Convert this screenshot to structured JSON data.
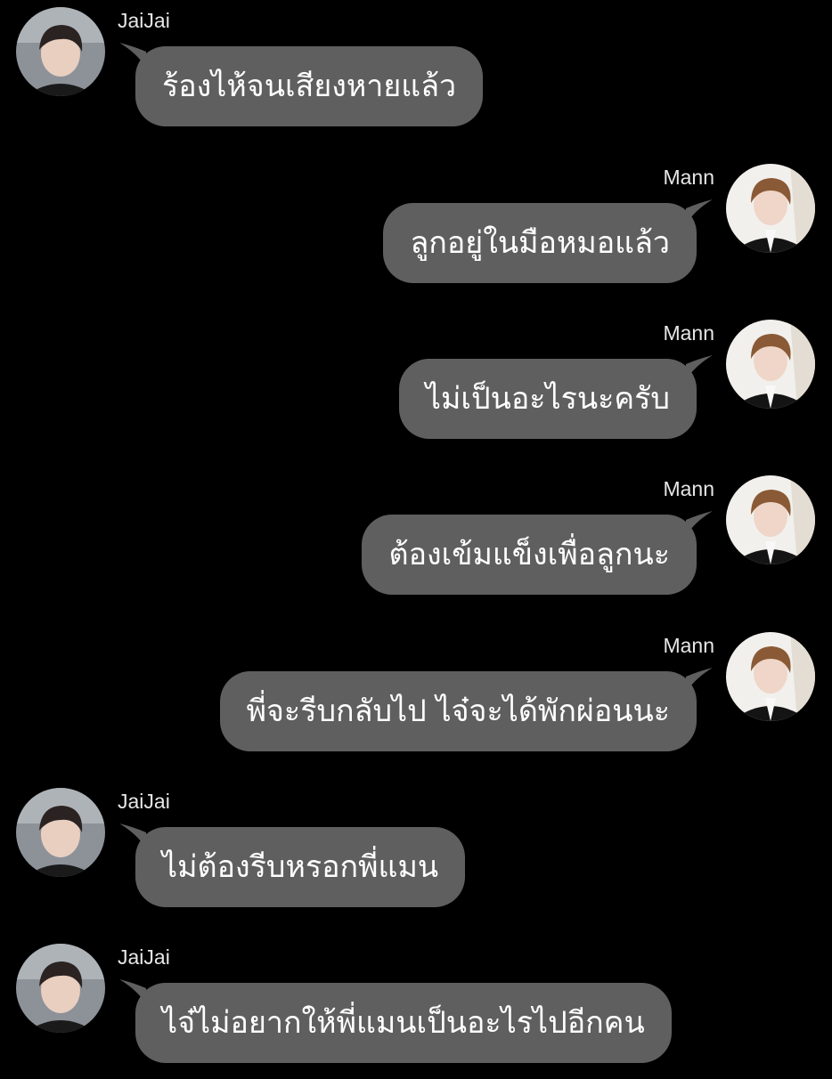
{
  "theme": {
    "background": "#000000",
    "bubble_color": "#5f5f5f",
    "text_color": "#ffffff",
    "name_color": "#e6e6e6"
  },
  "messages": [
    {
      "sender": "JaiJai",
      "side": "left",
      "avatar": "jaijai-avatar",
      "text": "ร้องไห้จนเสียงหายแล้ว"
    },
    {
      "sender": "Mann",
      "side": "right",
      "avatar": "mann-avatar",
      "text": "ลูกอยู่ในมือหมอแล้ว"
    },
    {
      "sender": "Mann",
      "side": "right",
      "avatar": "mann-avatar",
      "text": "ไม่เป็นอะไรนะครับ"
    },
    {
      "sender": "Mann",
      "side": "right",
      "avatar": "mann-avatar",
      "text": "ต้องเข้มแข็งเพื่อลูกนะ"
    },
    {
      "sender": "Mann",
      "side": "right",
      "avatar": "mann-avatar",
      "text": "พี่จะรีบกลับไป ไจ๋จะได้พักผ่อนนะ"
    },
    {
      "sender": "JaiJai",
      "side": "left",
      "avatar": "jaijai-avatar",
      "text": "ไม่ต้องรีบหรอกพี่แมน"
    },
    {
      "sender": "JaiJai",
      "side": "left",
      "avatar": "jaijai-avatar",
      "text": "ไจ๋ไม่อยากให้พี่แมนเป็นอะไรไปอีกคน"
    }
  ]
}
